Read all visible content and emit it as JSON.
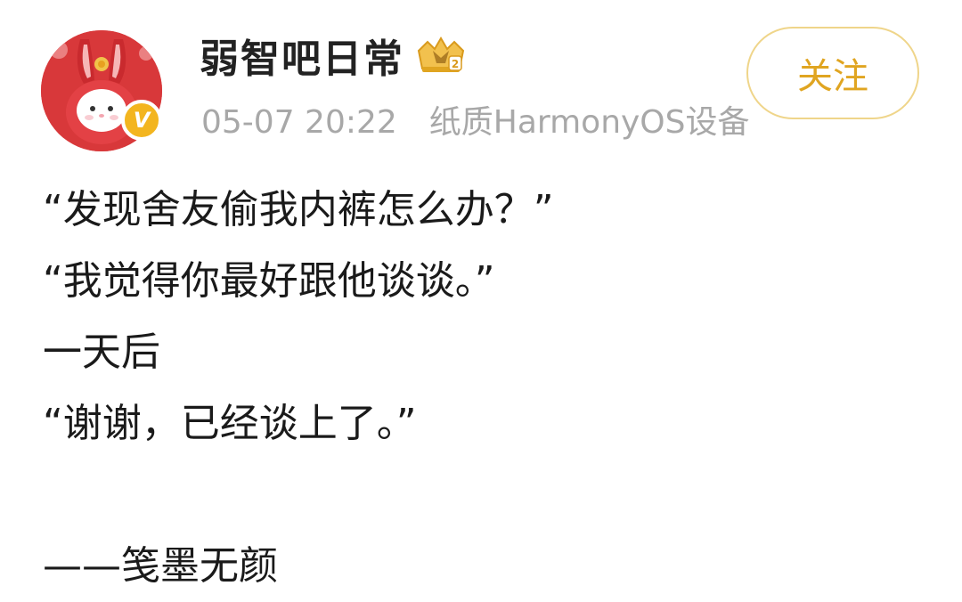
{
  "post": {
    "author": {
      "name": "弱智吧日常",
      "avatar_icon": "rabbit-avatar",
      "verified_icon": "verified-v-badge",
      "verified_label": "V",
      "badge_icon": "crown-level-badge"
    },
    "timestamp": "05-07 20:22",
    "device": "纸质HarmonyOS设备",
    "follow_label": "关注",
    "content_lines": [
      "“发现舍友偷我内裤怎么办？”",
      "“我觉得你最好跟他谈谈。”",
      "一天后",
      "“谢谢，已经谈上了。”",
      "",
      "——笺墨无颜"
    ]
  },
  "colors": {
    "accent": "#e0a521",
    "follow_border": "#efd58a",
    "meta_text": "#a8a8a8",
    "verified": "#f3b51f",
    "avatar_bg": "#d8383a"
  }
}
